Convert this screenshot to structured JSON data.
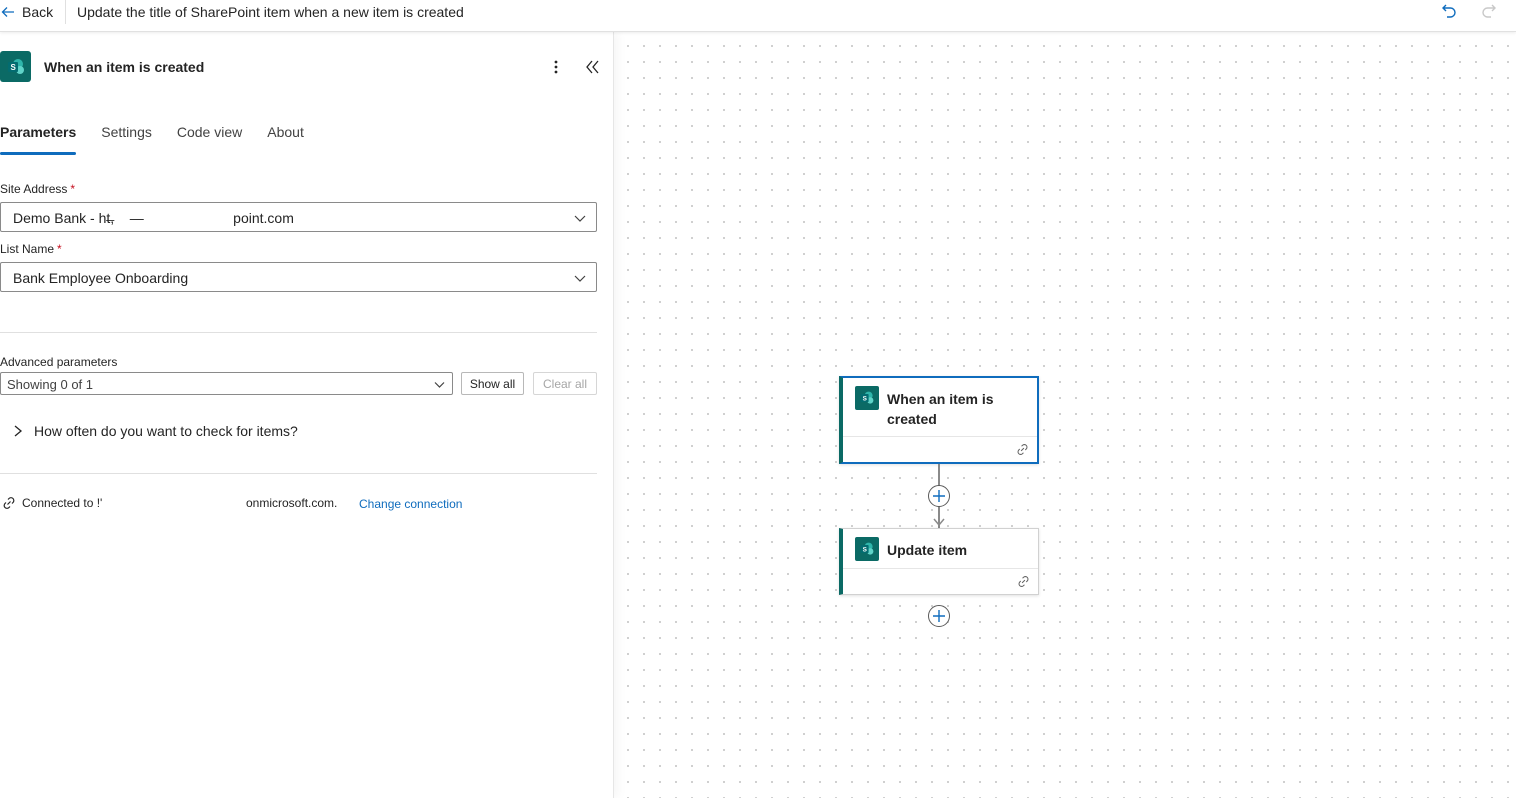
{
  "topbar": {
    "back_label": "Back",
    "flow_title": "Update the title of SharePoint item when a new item is created"
  },
  "panel": {
    "title": "When an item is created",
    "tabs": [
      "Parameters",
      "Settings",
      "Code view",
      "About"
    ],
    "active_tab": "Parameters",
    "site_address": {
      "label": "Site Address",
      "required_mark": "*",
      "value": "Demo Bank - ht̶,    —                       point.com"
    },
    "list_name": {
      "label": "List Name",
      "required_mark": "*",
      "value": "Bank Employee Onboarding"
    },
    "advanced": {
      "label": "Advanced parameters",
      "select_value": "Showing 0 of 1",
      "show_all": "Show all",
      "clear_all": "Clear all"
    },
    "frequency_label": "How often do you want to check for items?",
    "connection": {
      "prefix": "Connected to !'",
      "domain": "onmicrosoft.com.",
      "change_label": "Change connection"
    }
  },
  "canvas": {
    "nodes": [
      {
        "title": "When an item is created",
        "selected": true
      },
      {
        "title": "Update item",
        "selected": false
      }
    ]
  },
  "colors": {
    "sharepoint_teal": "#0b6a65",
    "accent_blue": "#0f6cbd",
    "required_red": "#c50f1f"
  },
  "icons": [
    "back-arrow-icon",
    "undo-icon",
    "redo-icon",
    "sharepoint-icon",
    "more-vertical-icon",
    "collapse-panel-icon",
    "chevron-down-icon",
    "chevron-right-icon",
    "link-icon",
    "add-step-icon"
  ]
}
